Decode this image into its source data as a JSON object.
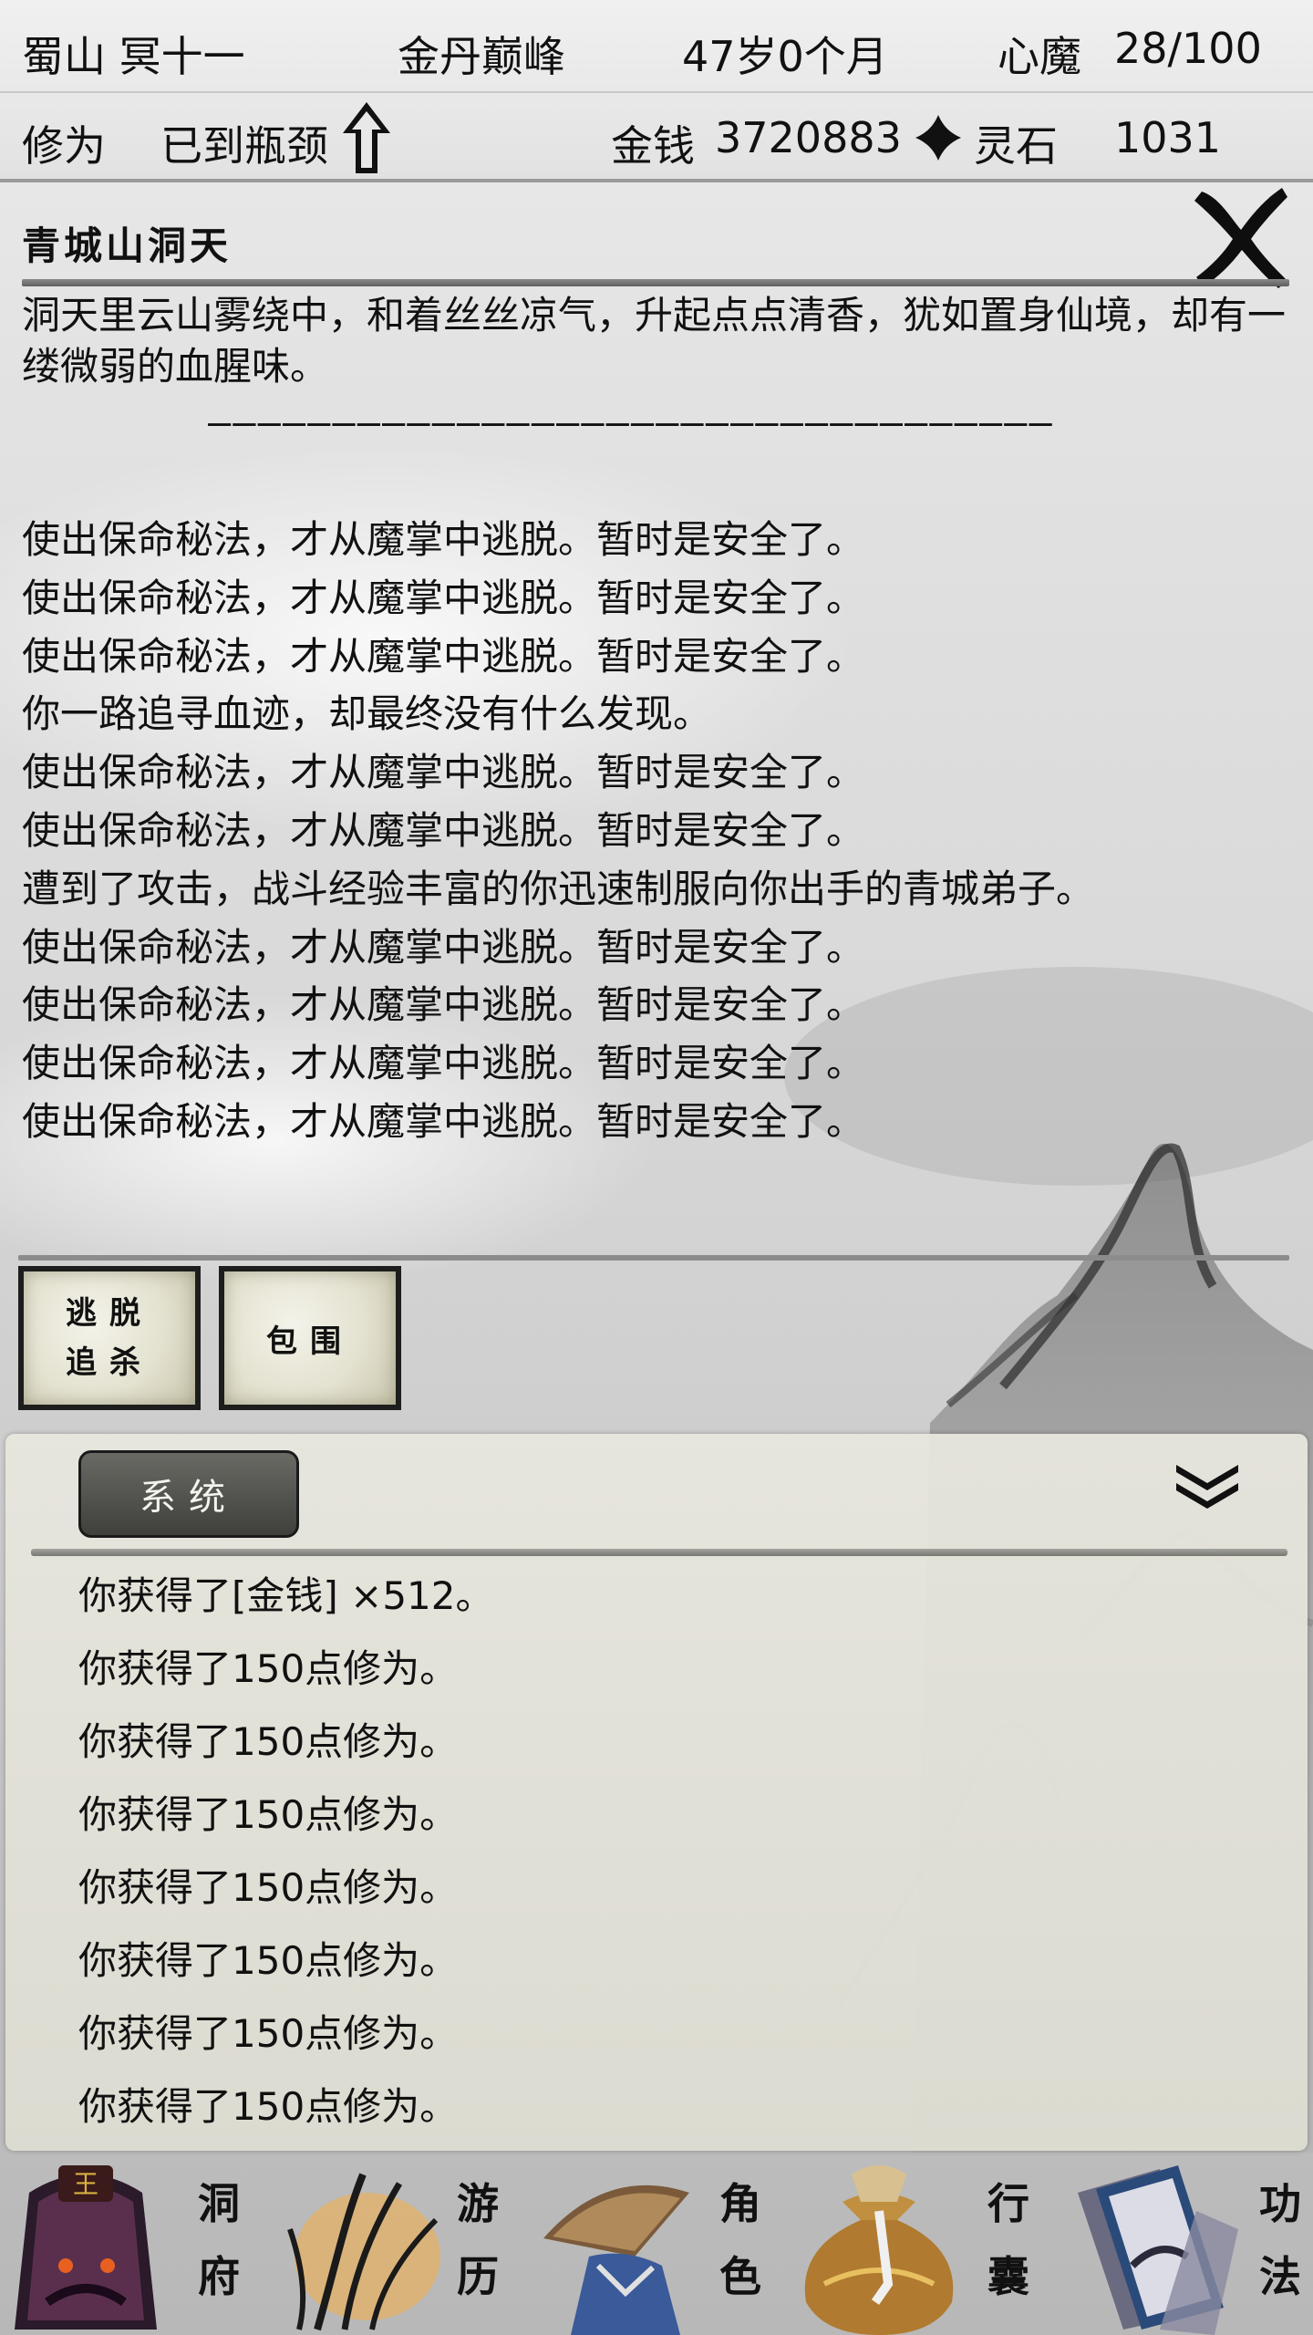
{
  "status": {
    "location": "蜀山 冥十一",
    "realm": "金丹巅峰",
    "age": "47岁0个月",
    "demon_label": "心魔",
    "demon_value": "28/100",
    "cultivation_label": "修为",
    "cultivation_value": "已到瓶颈",
    "money_label": "金钱",
    "money_value": "3720883",
    "stone_label": "灵石",
    "stone_value": "1031"
  },
  "location_panel": {
    "title": "青城山洞天",
    "description": "洞天里云山雾绕中，和着丝丝凉气，升起点点清香，犹如置身仙境，却有一缕微弱的血腥味。",
    "divider": "——————————————————————————————————"
  },
  "event_log": [
    "使出保命秘法，才从魔掌中逃脱。暂时是安全了。",
    "使出保命秘法，才从魔掌中逃脱。暂时是安全了。",
    "使出保命秘法，才从魔掌中逃脱。暂时是安全了。",
    "你一路追寻血迹，却最终没有什么发现。",
    "使出保命秘法，才从魔掌中逃脱。暂时是安全了。",
    "使出保命秘法，才从魔掌中逃脱。暂时是安全了。",
    "遭到了攻击，战斗经验丰富的你迅速制服向你出手的青城弟子。",
    "使出保命秘法，才从魔掌中逃脱。暂时是安全了。",
    "使出保命秘法，才从魔掌中逃脱。暂时是安全了。",
    "使出保命秘法，才从魔掌中逃脱。暂时是安全了。",
    "使出保命秘法，才从魔掌中逃脱。暂时是安全了。"
  ],
  "actions": {
    "escape_line1": "逃脱",
    "escape_line2": "追杀",
    "surround": "包围"
  },
  "system_panel": {
    "tab_label": "系统",
    "messages": [
      "你获得了[金钱] ×512。",
      "你获得了150点修为。",
      "你获得了150点修为。",
      "你获得了150点修为。",
      "你获得了150点修为。",
      "你获得了150点修为。",
      "你获得了150点修为。",
      "你获得了150点修为。"
    ]
  },
  "nav": [
    {
      "top": "洞",
      "bottom": "府",
      "icon": "cave-icon"
    },
    {
      "top": "游",
      "bottom": "历",
      "icon": "travel-icon"
    },
    {
      "top": "角",
      "bottom": "色",
      "icon": "character-icon"
    },
    {
      "top": "行",
      "bottom": "囊",
      "icon": "bag-icon"
    },
    {
      "top": "功",
      "bottom": "法",
      "icon": "skill-book-icon"
    }
  ],
  "colors": {
    "ink": "#111111",
    "tab_bg": "#4a4a46",
    "panel_bg": "#e6e5dc"
  }
}
